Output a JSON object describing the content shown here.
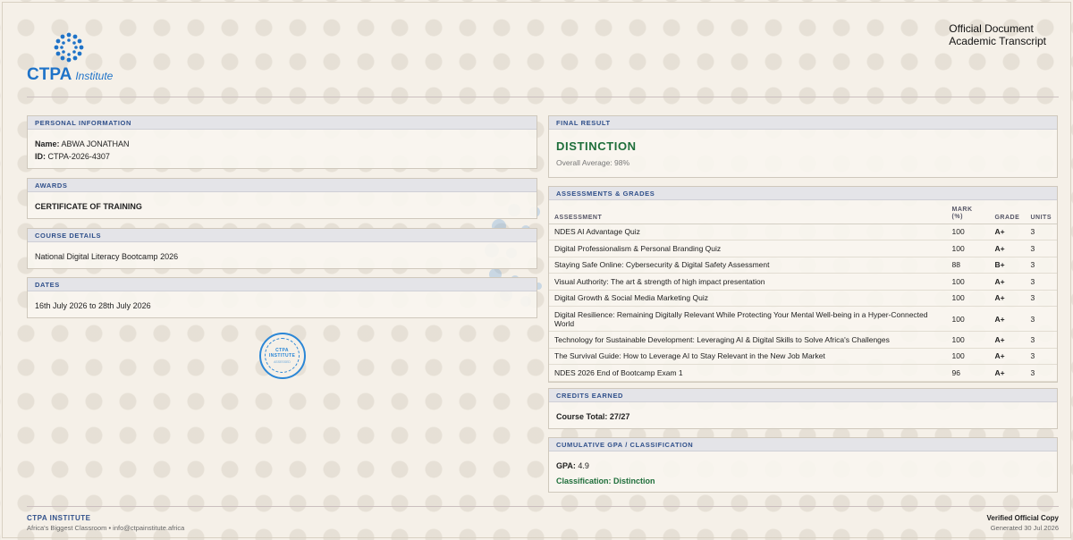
{
  "header": {
    "brand_name": "CTPA",
    "brand_suffix": "Institute",
    "doc_line1": "Official Document",
    "doc_line2": "Academic Transcript",
    "accent": "#1f73c8"
  },
  "personal": {
    "heading": "PERSONAL INFORMATION",
    "name_label": "Name:",
    "name_value": "ABWA JONATHAN",
    "id_label": "ID:",
    "id_value": "CTPA-2026-4307"
  },
  "awards": {
    "heading": "AWARDS",
    "value": "CERTIFICATE OF TRAINING"
  },
  "course": {
    "heading": "COURSE DETAILS",
    "value": "National Digital Literacy Bootcamp 2026"
  },
  "dates": {
    "heading": "DATES",
    "value": "16th July 2026 to 28th July 2026"
  },
  "seal": {
    "line1": "CTPA",
    "line2": "INSTITUTE",
    "line3": "ASSESSED"
  },
  "final": {
    "heading": "FINAL RESULT",
    "result": "DISTINCTION",
    "average": "Overall Average: 98%",
    "result_color": "#1e6e3a"
  },
  "assessments": {
    "heading": "ASSESSMENTS & GRADES",
    "col_assessment": "ASSESSMENT",
    "col_mark": "MARK (%)",
    "col_grade": "GRADE",
    "col_units": "UNITS",
    "rows": [
      {
        "name": "NDES AI Advantage Quiz",
        "mark": "100",
        "grade": "A+",
        "units": "3"
      },
      {
        "name": "Digital Professionalism & Personal Branding Quiz",
        "mark": "100",
        "grade": "A+",
        "units": "3"
      },
      {
        "name": "Staying Safe Online: Cybersecurity & Digital Safety Assessment",
        "mark": "88",
        "grade": "B+",
        "units": "3"
      },
      {
        "name": "Visual Authority: The art & strength of high impact presentation",
        "mark": "100",
        "grade": "A+",
        "units": "3"
      },
      {
        "name": "Digital Growth & Social Media Marketing Quiz",
        "mark": "100",
        "grade": "A+",
        "units": "3"
      },
      {
        "name": "Digital Resilience: Remaining Digitally Relevant While Protecting Your Mental Well-being in a Hyper-Connected World",
        "mark": "100",
        "grade": "A+",
        "units": "3"
      },
      {
        "name": "Technology for Sustainable Development: Leveraging AI & Digital Skills to Solve Africa's Challenges",
        "mark": "100",
        "grade": "A+",
        "units": "3"
      },
      {
        "name": "The Survival Guide: How to Leverage AI to Stay Relevant in the New Job Market",
        "mark": "100",
        "grade": "A+",
        "units": "3"
      },
      {
        "name": "NDES 2026 End of Bootcamp Exam 1",
        "mark": "96",
        "grade": "A+",
        "units": "3"
      }
    ]
  },
  "credits": {
    "heading": "CREDITS EARNED",
    "value": "Course Total: 27/27"
  },
  "gpa": {
    "heading": "CUMULATIVE GPA / CLASSIFICATION",
    "gpa_label": "GPA:",
    "gpa_value": "4.9",
    "classification": "Classification: Distinction"
  },
  "footer": {
    "org": "CTPA INSTITUTE",
    "tagline": "Africa's Biggest Classroom • info@ctpainstitute.africa",
    "verified": "Verified Official Copy",
    "generated": "Generated 30 Jul 2026"
  }
}
